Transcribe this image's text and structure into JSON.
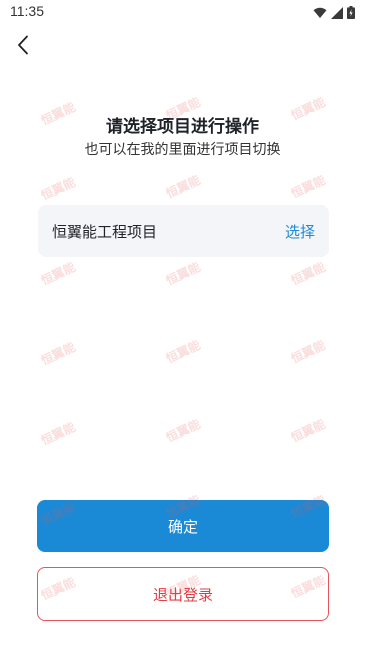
{
  "status_bar": {
    "time": "11:35"
  },
  "header": {
    "title": "请选择项目进行操作",
    "subtitle": "也可以在我的里面进行项目切换"
  },
  "project": {
    "name": "恒翼能工程项目",
    "select_label": "选择"
  },
  "actions": {
    "confirm_label": "确定",
    "logout_label": "退出登录"
  },
  "watermark": {
    "text": "恒翼能"
  },
  "colors": {
    "primary": "#1a89d6",
    "link": "#1c8ad8",
    "danger": "#e23c44",
    "card_bg": "#f3f5f8"
  }
}
